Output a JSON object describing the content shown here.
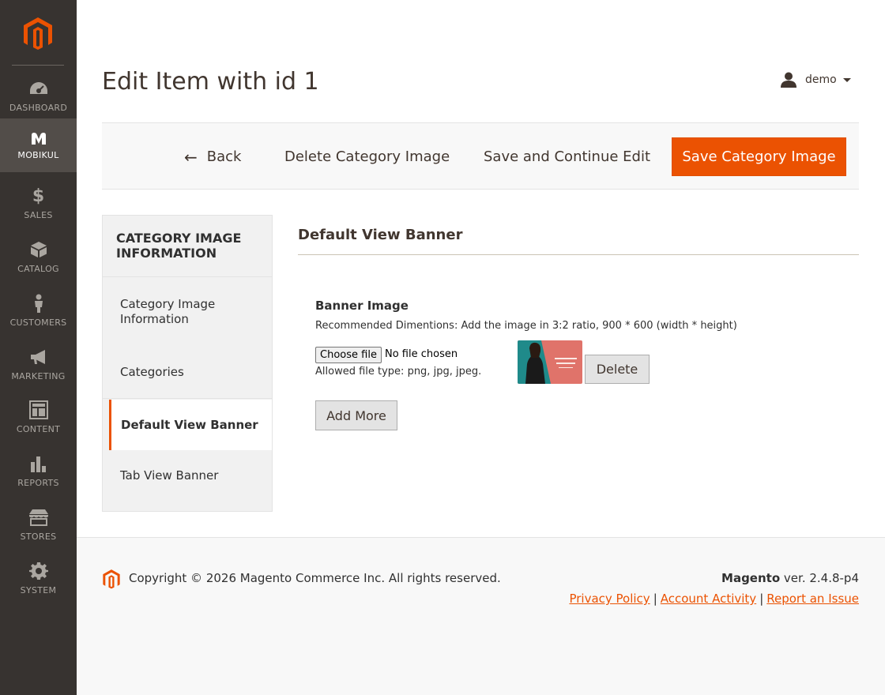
{
  "sidebar": {
    "items": [
      {
        "label": "DASHBOARD",
        "icon": "dashboard-icon"
      },
      {
        "label": "MOBIKUL",
        "icon": "mobikul-icon",
        "active": true
      },
      {
        "label": "SALES",
        "icon": "dollar-icon"
      },
      {
        "label": "CATALOG",
        "icon": "box-icon"
      },
      {
        "label": "CUSTOMERS",
        "icon": "person-icon"
      },
      {
        "label": "MARKETING",
        "icon": "megaphone-icon"
      },
      {
        "label": "CONTENT",
        "icon": "layout-icon"
      },
      {
        "label": "REPORTS",
        "icon": "bar-chart-icon"
      },
      {
        "label": "STORES",
        "icon": "store-icon"
      },
      {
        "label": "SYSTEM",
        "icon": "gear-icon"
      }
    ]
  },
  "header": {
    "title": "Edit Item with id 1",
    "user": "demo"
  },
  "toolbar": {
    "back_label": "Back",
    "delete_label": "Delete Category Image",
    "save_continue_label": "Save and Continue Edit",
    "save_label": "Save Category Image"
  },
  "tabs": {
    "title": "CATEGORY IMAGE INFORMATION",
    "items": [
      {
        "label": "Category Image Information"
      },
      {
        "label": "Categories"
      },
      {
        "label": "Default View Banner",
        "active": true
      },
      {
        "label": "Tab View Banner"
      }
    ]
  },
  "main": {
    "section_title": "Default View Banner",
    "field_label": "Banner Image",
    "note": "Recommended Dimentions: Add the image in 3:2 ratio, 900 * 600 (width * height)",
    "choose_file_label": "Choose file",
    "file_status": "No file chosen",
    "allowed_types": "Allowed file type: png, jpg, jpeg.",
    "delete_label": "Delete",
    "add_more_label": "Add More"
  },
  "footer": {
    "copyright": "Copyright © 2026 Magento Commerce Inc. All rights reserved.",
    "brand": "Magento",
    "version": "ver. 2.4.8-p4",
    "links": {
      "privacy": "Privacy Policy",
      "activity": "Account Activity",
      "report": "Report an Issue"
    }
  },
  "colors": {
    "accent": "#eb5202",
    "sidebar_bg": "#373330",
    "sidebar_active_bg": "#524d49"
  }
}
